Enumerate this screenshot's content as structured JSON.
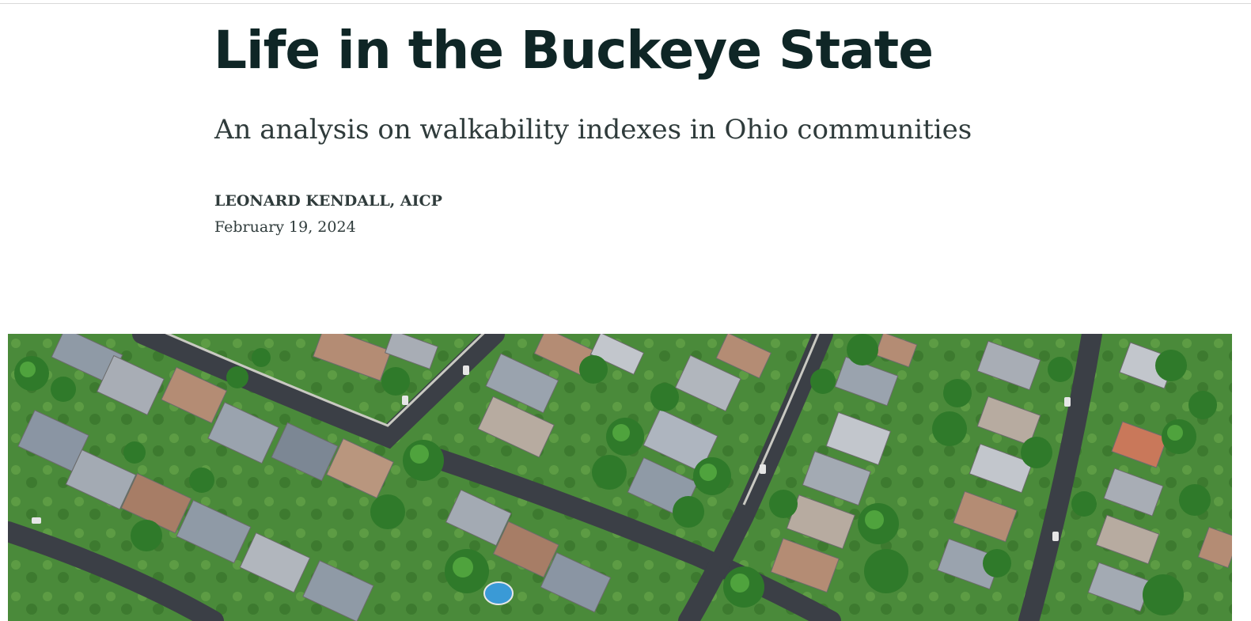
{
  "article": {
    "title": "Life in the Buckeye State",
    "subtitle": "An analysis on walkability indexes in Ohio communities",
    "author": "LEONARD KENDALL, AICP",
    "date": "February 19, 2024"
  },
  "hero_image": {
    "icon": "aerial-suburban-neighborhood-photo"
  }
}
